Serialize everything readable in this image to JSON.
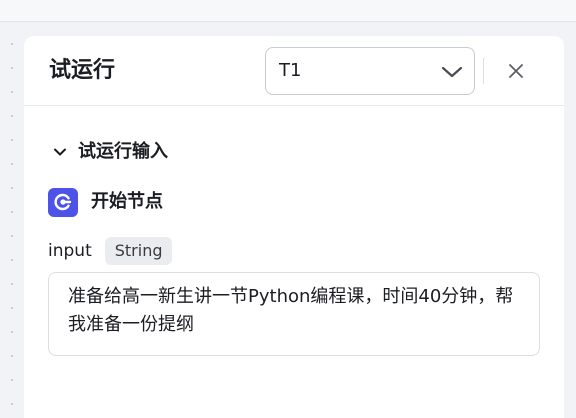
{
  "panel": {
    "title": "试运行",
    "selected_case": "T1"
  },
  "section": {
    "label": "试运行输入",
    "expanded": true
  },
  "node": {
    "label": "开始节点",
    "icon": "start-node-icon",
    "icon_color": "#4d53e8"
  },
  "field": {
    "name": "input",
    "type": "String",
    "value": "准备给高一新生讲一节Python编程课，时间40分钟，帮我准备一份提纲"
  }
}
